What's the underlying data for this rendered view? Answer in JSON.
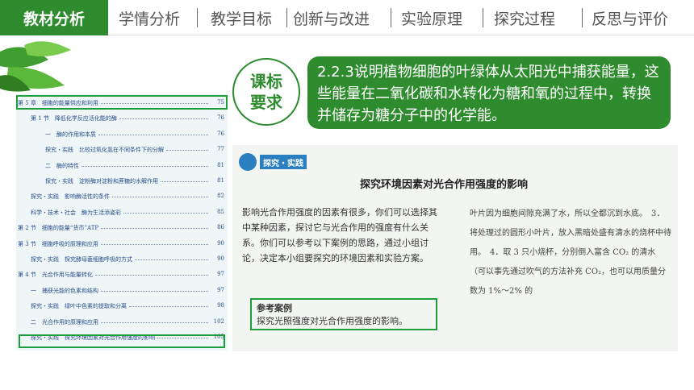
{
  "nav": {
    "active": "教材分析",
    "items": [
      "学情分析",
      "教学目标",
      "创新与改进",
      "实验原理",
      "探究过程",
      "反思与评价"
    ]
  },
  "circle_label": "课标要求",
  "standard_text": "2.2.3说明植物细胞的叶绿体从太阳光中捕获能量，这些能量在二氧化碳和水转化为糖和氧的过程中，转换并储存为糖分子中的化学能。",
  "toc": [
    {
      "text": "第 5 章　细胞的能量供应和利用",
      "page": "75"
    },
    {
      "text": "第 1 节　降低化学反应活化能的酶",
      "page": "76"
    },
    {
      "text": "一　酶的作用和本质",
      "page": "76"
    },
    {
      "text": "探究・实践　比较过氧化氢在不同条件下的分解",
      "page": "77"
    },
    {
      "text": "二　酶的特性",
      "page": "81"
    },
    {
      "text": "探究・实践　淀粉酶对淀粉和蔗糖的水解作用",
      "page": "81"
    },
    {
      "text": "探究・实践　影响酶活性的条件",
      "page": "82"
    },
    {
      "text": "科学・技术・社会　酶为生活添姿彩",
      "page": "85"
    },
    {
      "text": "第 2 节　细胞的能量“货币”ATP",
      "page": "86"
    },
    {
      "text": "第 3 节　细胞呼吸的原理和应用",
      "page": "90"
    },
    {
      "text": "探究・实践　探究酵母菌细胞呼吸的方式",
      "page": "90"
    },
    {
      "text": "第 4 节　光合作用与能量转化",
      "page": "97"
    },
    {
      "text": "一　捕获光能的色素和结构",
      "page": "97"
    },
    {
      "text": "探究・实践　绿叶中色素的提取和分离",
      "page": "98"
    },
    {
      "text": "二　光合作用的原理和应用",
      "page": "102"
    },
    {
      "text": "探究・实践　探究环境因素对光合作用强度的影响",
      "page": "105"
    }
  ],
  "book": {
    "tag": "探究・实践",
    "title": "探究环境因素对光合作用强度的影响",
    "left_paragraph": "影响光合作用强度的因素有很多，你们可以选择其中某种因素，探讨它与光合作用的强度有什么关系。你们可以参考以下案例的思路，通过小组讨论，决定本小组要探究的环境因素和实验方案。",
    "ref_title": "参考案例",
    "ref_text": "探究光照强度对光合作用强度的影响。",
    "right_paragraph": "叶片因为细胞间隙充满了水，所以全都沉到水底。　3．将处理过的圆形小叶片，放入黑暗处盛有清水的烧杯中待用。　4．取 3 只小烧杯，分别倒入富含 CO₂ 的清水（可以事先通过吹气的方法补充 CO₂，也可以用质量分数为 1%～2% 的"
  },
  "colors": {
    "accent": "#2e8b2e",
    "highlight": "#1e9e3a",
    "toc_text": "#2a4d8a"
  }
}
